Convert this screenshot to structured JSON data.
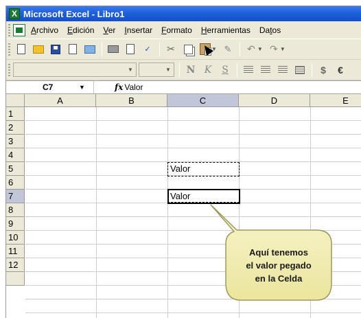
{
  "window": {
    "title": "Microsoft Excel - Libro1",
    "app_icon": "excel-icon"
  },
  "menubar": {
    "items": [
      {
        "label_pre": "",
        "label_u": "A",
        "label_post": "rchivo"
      },
      {
        "label_pre": "",
        "label_u": "E",
        "label_post": "dición"
      },
      {
        "label_pre": "",
        "label_u": "V",
        "label_post": "er"
      },
      {
        "label_pre": "",
        "label_u": "I",
        "label_post": "nsertar"
      },
      {
        "label_pre": "",
        "label_u": "F",
        "label_post": "ormato"
      },
      {
        "label_pre": "",
        "label_u": "H",
        "label_post": "erramientas"
      },
      {
        "label_pre": "Da",
        "label_u": "t",
        "label_post": "os"
      }
    ]
  },
  "format_toolbar": {
    "bold": "N",
    "italic": "K",
    "underline": "S",
    "currency": "$",
    "euro": "€"
  },
  "formula_bar": {
    "name_box": "C7",
    "fx": "fx",
    "formula": "Valor"
  },
  "grid": {
    "columns": [
      "A",
      "B",
      "C",
      "D",
      "E"
    ],
    "selected_column": "C",
    "rows": [
      "1",
      "2",
      "3",
      "4",
      "5",
      "6",
      "7",
      "8",
      "9",
      "10",
      "11",
      "12"
    ],
    "selected_row": "7",
    "cells": {
      "C5": "Valor",
      "C7": "Valor"
    }
  },
  "callout": {
    "lines": [
      "Aquí tenemos",
      "el valor pegado",
      "en la Celda"
    ],
    "fill": "#f3efb8",
    "stroke": "#9c9a5a"
  }
}
